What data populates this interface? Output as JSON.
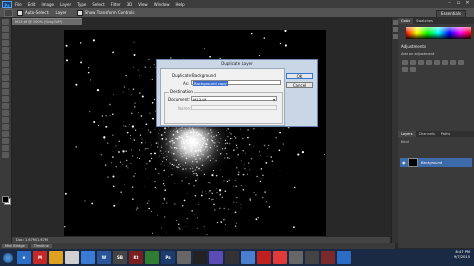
{
  "app": {
    "logo": "Ps",
    "menu": [
      "File",
      "Edit",
      "Image",
      "Layer",
      "Type",
      "Select",
      "Filter",
      "3D",
      "View",
      "Window",
      "Help"
    ],
    "window_controls": [
      "–",
      "▫",
      "✕"
    ]
  },
  "options_bar": {
    "auto_select_label": "Auto-Select:",
    "auto_select_value": "Layer",
    "show_transform_label": "Show Transform Controls",
    "workspace": "Essentials"
  },
  "document": {
    "tab_title": "M13.tif @ 100% (Gray/16*)",
    "status": "Doc: 1.67M/1.67M"
  },
  "bottom_panel": {
    "tab": "Mini Bridge",
    "tab2": "Timeline"
  },
  "panels": {
    "top_tabs": [
      "Color",
      "Swatches"
    ],
    "adjustments_title": "Adjustments",
    "add_adjustment_label": "Add an adjustment",
    "layers_tabs": [
      "Layers",
      "Channels",
      "Paths"
    ],
    "layers_kind_label": "Kind",
    "layer_name": "Background"
  },
  "dialog": {
    "title": "Duplicate Layer",
    "duplicate_label": "Duplicate:",
    "duplicate_value": "Background",
    "as_label": "As:",
    "as_value": "Background copy",
    "destination_label": "Destination",
    "document_label": "Document:",
    "document_value": "M13.tif",
    "name_label": "Name:",
    "ok_label": "OK",
    "cancel_label": "Cancel"
  },
  "taskbar": {
    "apps": [
      {
        "label": "e",
        "color": "#2b6cc4"
      },
      {
        "label": "M",
        "color": "#c62828"
      },
      {
        "label": "",
        "color": "#e0a020"
      },
      {
        "label": "",
        "color": "#d0d0d0"
      },
      {
        "label": "",
        "color": "#3a7bd5"
      },
      {
        "label": "W",
        "color": "#2a5699"
      },
      {
        "label": "SB",
        "color": "#444"
      },
      {
        "label": "Kt",
        "color": "#7a1f1f"
      },
      {
        "label": "",
        "color": "#2e7d32"
      },
      {
        "label": "Ps",
        "color": "#1b3d6e"
      },
      {
        "label": "",
        "color": "#666"
      },
      {
        "label": "",
        "color": "#222"
      },
      {
        "label": "",
        "color": "#5b4bb7"
      },
      {
        "label": "",
        "color": "#333"
      },
      {
        "label": "",
        "color": "#4a7fd0"
      },
      {
        "label": "",
        "color": "#c02020"
      },
      {
        "label": "",
        "color": "#e03a3a"
      },
      {
        "label": "",
        "color": "#666"
      },
      {
        "label": "",
        "color": "#444"
      },
      {
        "label": "",
        "color": "#7a2a2a"
      },
      {
        "label": "",
        "color": "#2b6cc4"
      }
    ],
    "time": "8:47 PM",
    "date": "9/7/2015"
  }
}
